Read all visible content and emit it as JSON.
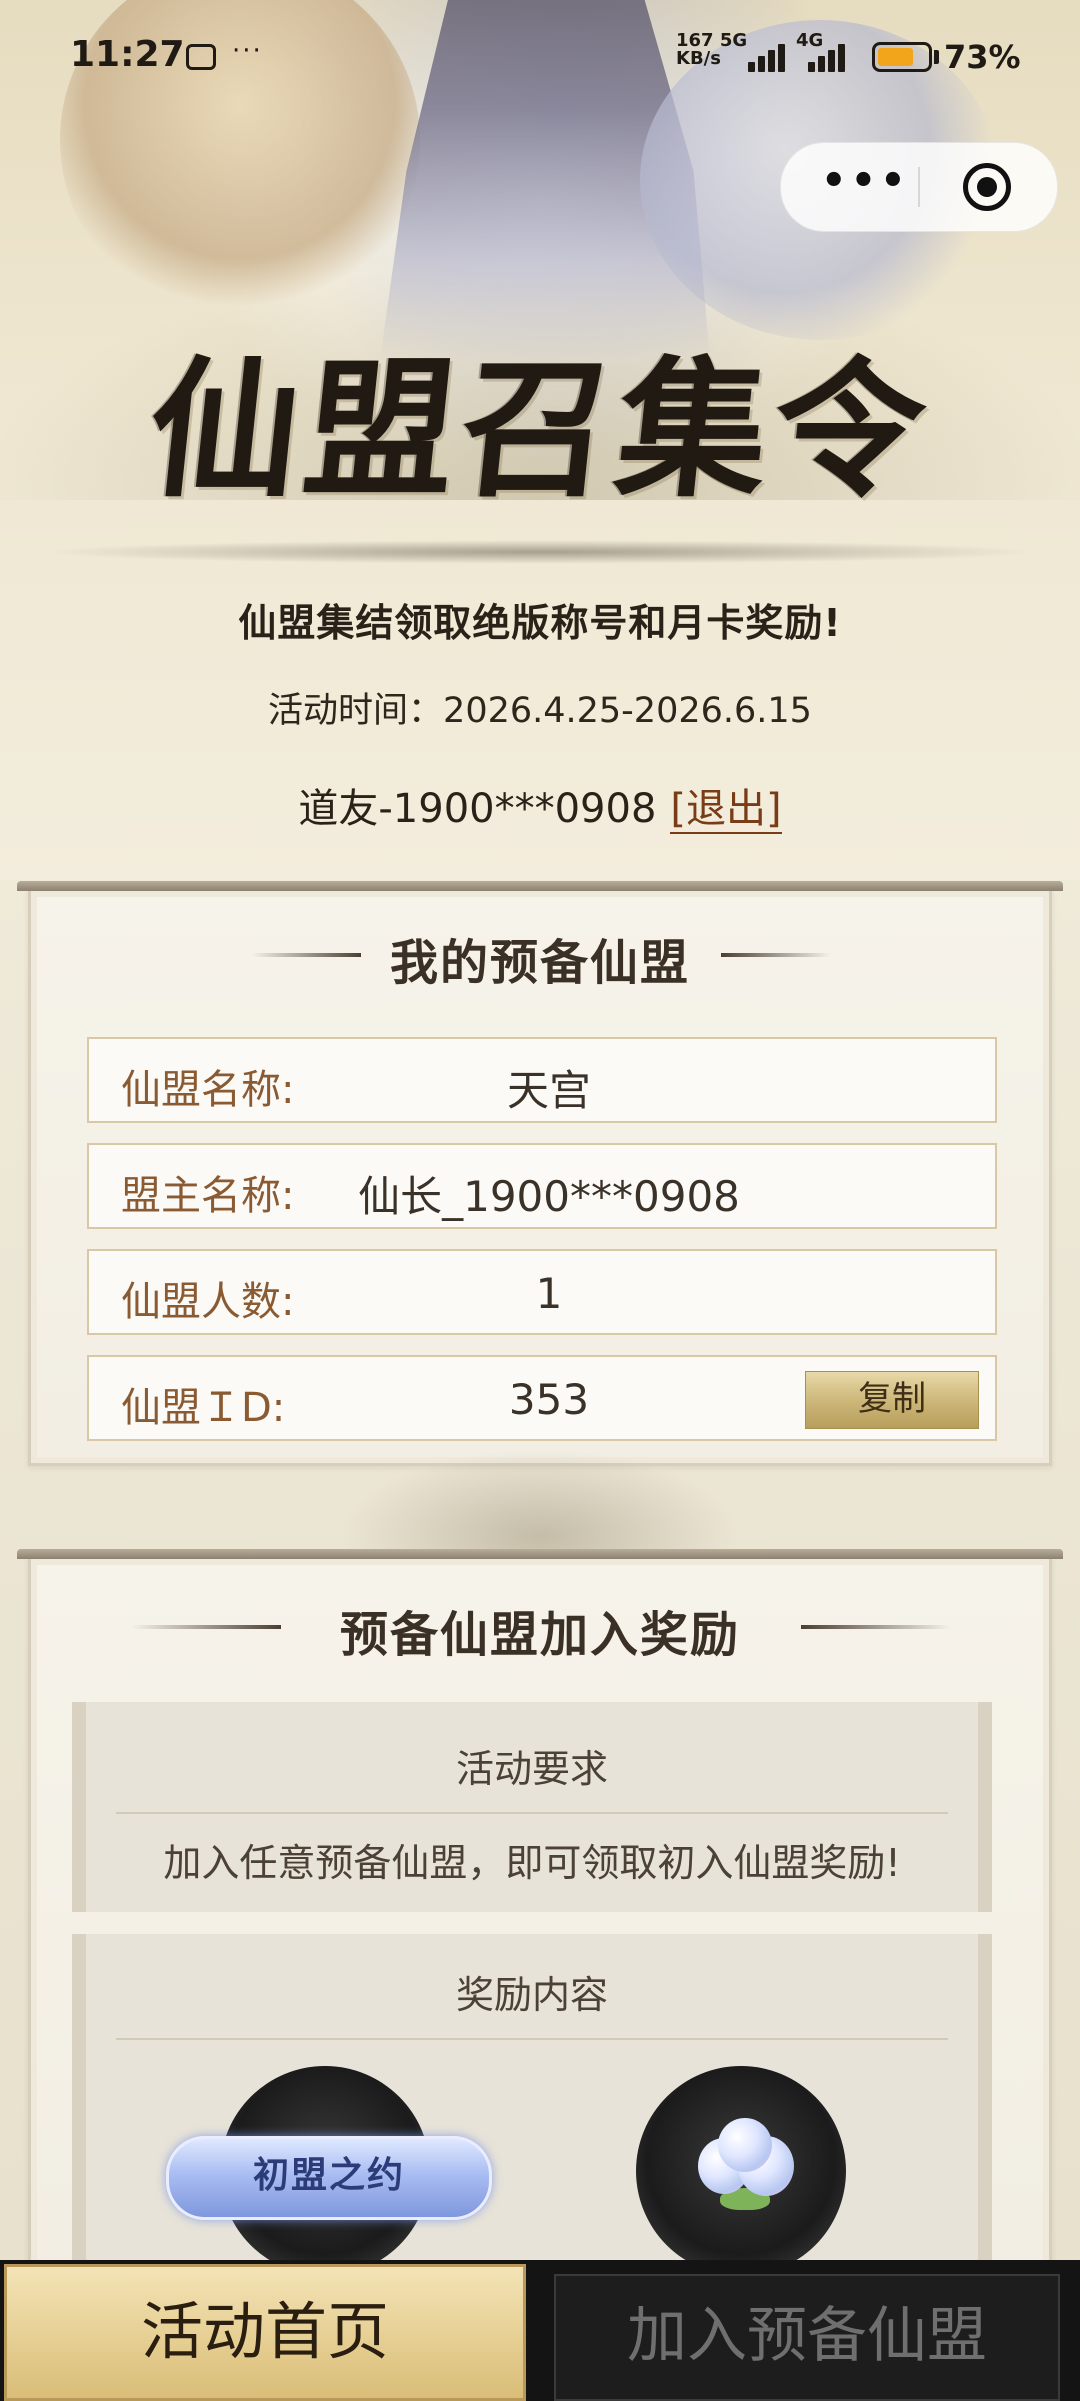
{
  "status_bar": {
    "time": "11:27",
    "network_speed": "167 5G",
    "speed_unit": "KB/s",
    "network_4g": "4G",
    "battery_percent": "73%",
    "battery_level": 0.73
  },
  "capsule": {
    "more_icon": "more-dots-icon",
    "close_icon": "record-close-icon"
  },
  "hero": {
    "title": "仙盟召集令",
    "subtitle": "仙盟集结领取绝版称号和月卡奖励!",
    "activity_time": "活动时间：2026.4.25-2026.6.15",
    "user_name": "道友-1900***0908",
    "logout_label": "[退出]"
  },
  "my_alliance": {
    "title": "我的预备仙盟",
    "rows": [
      {
        "label": "仙盟名称:",
        "value": "天宫"
      },
      {
        "label": "盟主名称:",
        "value": "仙长_1900***0908"
      },
      {
        "label": "仙盟人数:",
        "value": "1"
      },
      {
        "label": "仙盟ＩD:",
        "value": "353"
      }
    ],
    "copy_label": "复制"
  },
  "join_reward": {
    "title": "预备仙盟加入奖励",
    "requirement_head": "活动要求",
    "requirement_text": "加入任意预备仙盟，即可领取初入仙盟奖励!",
    "reward_head": "奖励内容",
    "reward_title_badge": "初盟之约"
  },
  "bottom_nav": {
    "home_label": "活动首页",
    "join_label": "加入预备仙盟"
  },
  "colors": {
    "accent_brown": "#8a5a32",
    "gold_button": "#cbb577",
    "nav_bg": "#141414"
  }
}
